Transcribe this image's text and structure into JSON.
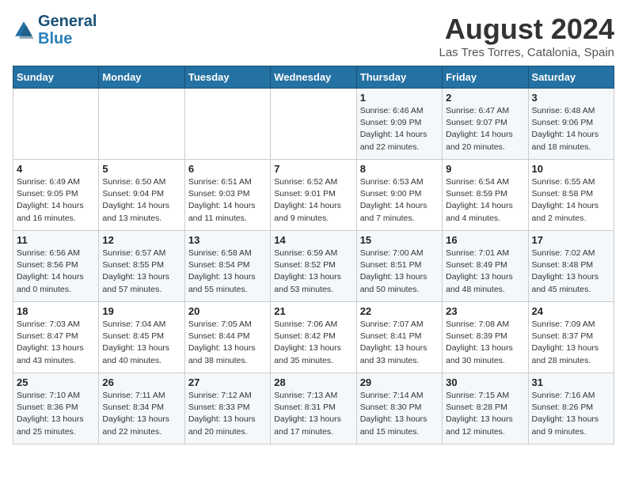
{
  "header": {
    "logo_general": "General",
    "logo_blue": "Blue",
    "month_year": "August 2024",
    "location": "Las Tres Torres, Catalonia, Spain"
  },
  "days_of_week": [
    "Sunday",
    "Monday",
    "Tuesday",
    "Wednesday",
    "Thursday",
    "Friday",
    "Saturday"
  ],
  "weeks": [
    [
      {
        "day": "",
        "info": ""
      },
      {
        "day": "",
        "info": ""
      },
      {
        "day": "",
        "info": ""
      },
      {
        "day": "",
        "info": ""
      },
      {
        "day": "1",
        "info": "Sunrise: 6:46 AM\nSunset: 9:09 PM\nDaylight: 14 hours\nand 22 minutes."
      },
      {
        "day": "2",
        "info": "Sunrise: 6:47 AM\nSunset: 9:07 PM\nDaylight: 14 hours\nand 20 minutes."
      },
      {
        "day": "3",
        "info": "Sunrise: 6:48 AM\nSunset: 9:06 PM\nDaylight: 14 hours\nand 18 minutes."
      }
    ],
    [
      {
        "day": "4",
        "info": "Sunrise: 6:49 AM\nSunset: 9:05 PM\nDaylight: 14 hours\nand 16 minutes."
      },
      {
        "day": "5",
        "info": "Sunrise: 6:50 AM\nSunset: 9:04 PM\nDaylight: 14 hours\nand 13 minutes."
      },
      {
        "day": "6",
        "info": "Sunrise: 6:51 AM\nSunset: 9:03 PM\nDaylight: 14 hours\nand 11 minutes."
      },
      {
        "day": "7",
        "info": "Sunrise: 6:52 AM\nSunset: 9:01 PM\nDaylight: 14 hours\nand 9 minutes."
      },
      {
        "day": "8",
        "info": "Sunrise: 6:53 AM\nSunset: 9:00 PM\nDaylight: 14 hours\nand 7 minutes."
      },
      {
        "day": "9",
        "info": "Sunrise: 6:54 AM\nSunset: 8:59 PM\nDaylight: 14 hours\nand 4 minutes."
      },
      {
        "day": "10",
        "info": "Sunrise: 6:55 AM\nSunset: 8:58 PM\nDaylight: 14 hours\nand 2 minutes."
      }
    ],
    [
      {
        "day": "11",
        "info": "Sunrise: 6:56 AM\nSunset: 8:56 PM\nDaylight: 14 hours\nand 0 minutes."
      },
      {
        "day": "12",
        "info": "Sunrise: 6:57 AM\nSunset: 8:55 PM\nDaylight: 13 hours\nand 57 minutes."
      },
      {
        "day": "13",
        "info": "Sunrise: 6:58 AM\nSunset: 8:54 PM\nDaylight: 13 hours\nand 55 minutes."
      },
      {
        "day": "14",
        "info": "Sunrise: 6:59 AM\nSunset: 8:52 PM\nDaylight: 13 hours\nand 53 minutes."
      },
      {
        "day": "15",
        "info": "Sunrise: 7:00 AM\nSunset: 8:51 PM\nDaylight: 13 hours\nand 50 minutes."
      },
      {
        "day": "16",
        "info": "Sunrise: 7:01 AM\nSunset: 8:49 PM\nDaylight: 13 hours\nand 48 minutes."
      },
      {
        "day": "17",
        "info": "Sunrise: 7:02 AM\nSunset: 8:48 PM\nDaylight: 13 hours\nand 45 minutes."
      }
    ],
    [
      {
        "day": "18",
        "info": "Sunrise: 7:03 AM\nSunset: 8:47 PM\nDaylight: 13 hours\nand 43 minutes."
      },
      {
        "day": "19",
        "info": "Sunrise: 7:04 AM\nSunset: 8:45 PM\nDaylight: 13 hours\nand 40 minutes."
      },
      {
        "day": "20",
        "info": "Sunrise: 7:05 AM\nSunset: 8:44 PM\nDaylight: 13 hours\nand 38 minutes."
      },
      {
        "day": "21",
        "info": "Sunrise: 7:06 AM\nSunset: 8:42 PM\nDaylight: 13 hours\nand 35 minutes."
      },
      {
        "day": "22",
        "info": "Sunrise: 7:07 AM\nSunset: 8:41 PM\nDaylight: 13 hours\nand 33 minutes."
      },
      {
        "day": "23",
        "info": "Sunrise: 7:08 AM\nSunset: 8:39 PM\nDaylight: 13 hours\nand 30 minutes."
      },
      {
        "day": "24",
        "info": "Sunrise: 7:09 AM\nSunset: 8:37 PM\nDaylight: 13 hours\nand 28 minutes."
      }
    ],
    [
      {
        "day": "25",
        "info": "Sunrise: 7:10 AM\nSunset: 8:36 PM\nDaylight: 13 hours\nand 25 minutes."
      },
      {
        "day": "26",
        "info": "Sunrise: 7:11 AM\nSunset: 8:34 PM\nDaylight: 13 hours\nand 22 minutes."
      },
      {
        "day": "27",
        "info": "Sunrise: 7:12 AM\nSunset: 8:33 PM\nDaylight: 13 hours\nand 20 minutes."
      },
      {
        "day": "28",
        "info": "Sunrise: 7:13 AM\nSunset: 8:31 PM\nDaylight: 13 hours\nand 17 minutes."
      },
      {
        "day": "29",
        "info": "Sunrise: 7:14 AM\nSunset: 8:30 PM\nDaylight: 13 hours\nand 15 minutes."
      },
      {
        "day": "30",
        "info": "Sunrise: 7:15 AM\nSunset: 8:28 PM\nDaylight: 13 hours\nand 12 minutes."
      },
      {
        "day": "31",
        "info": "Sunrise: 7:16 AM\nSunset: 8:26 PM\nDaylight: 13 hours\nand 9 minutes."
      }
    ]
  ]
}
